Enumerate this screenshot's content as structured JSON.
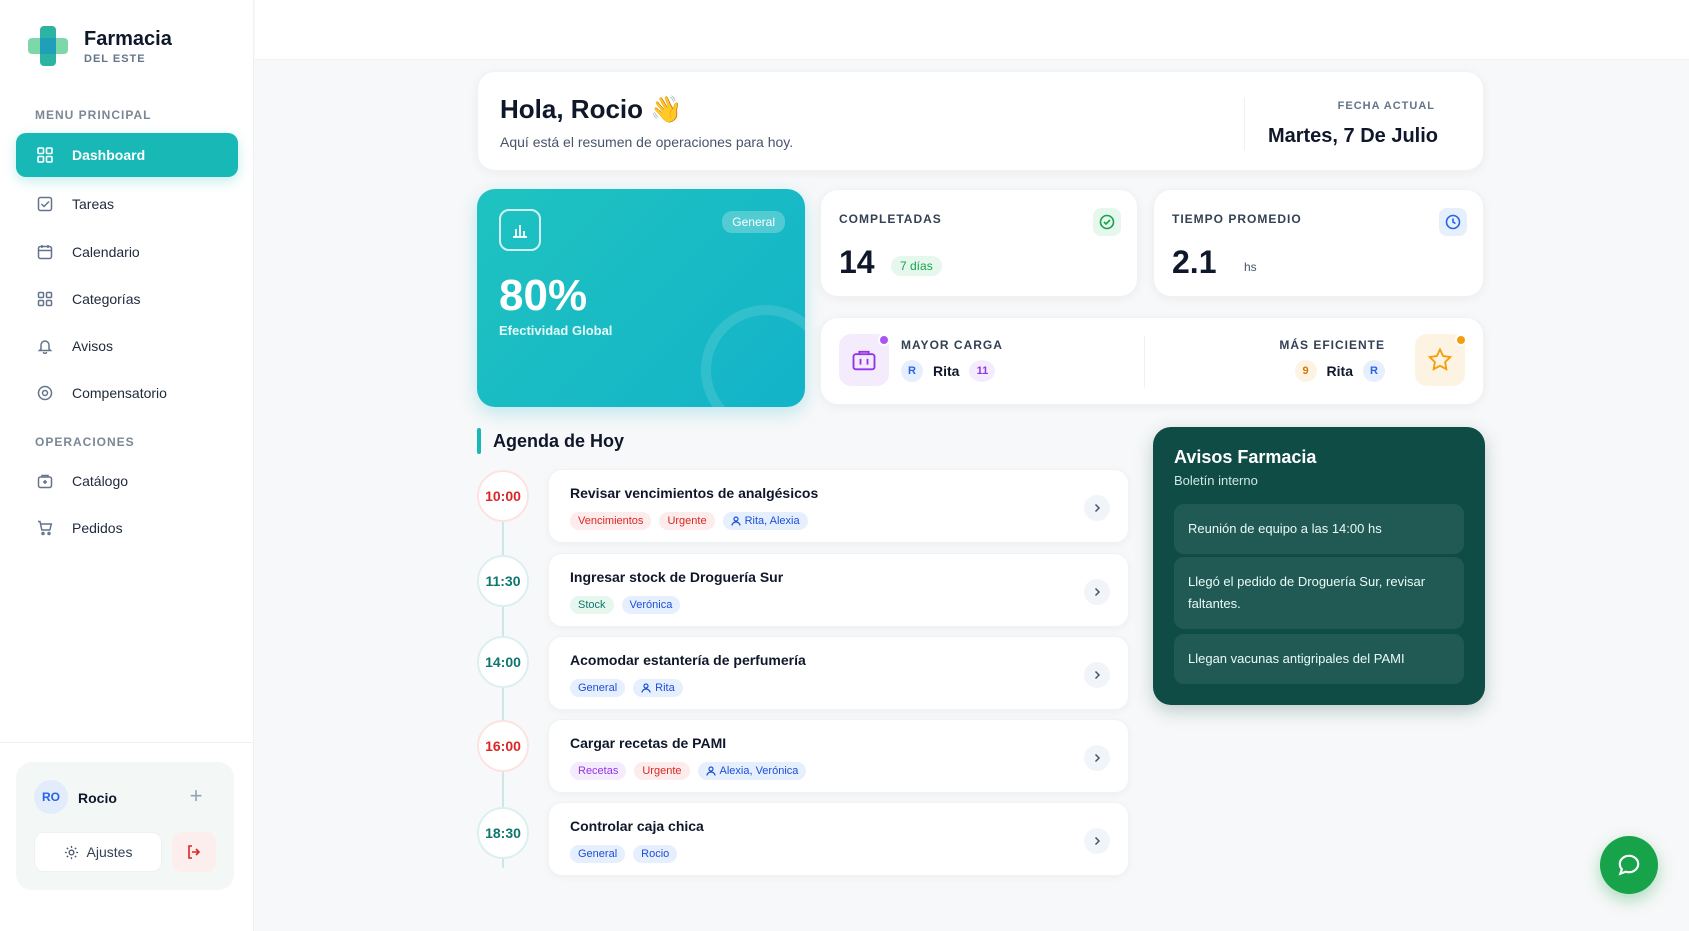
{
  "brand": {
    "name": "Farmacia",
    "sub": "DEL ESTE"
  },
  "sidebar": {
    "section_main": "MENU PRINCIPAL",
    "section_ops": "OPERACIONES",
    "items": [
      {
        "label": "Dashboard",
        "icon": "grid-icon",
        "active": true
      },
      {
        "label": "Tareas",
        "icon": "checkbox-icon"
      },
      {
        "label": "Calendario",
        "icon": "calendar-icon"
      },
      {
        "label": "Categorías",
        "icon": "categories-icon"
      },
      {
        "label": "Avisos",
        "icon": "bell-icon"
      },
      {
        "label": "Compensatorio",
        "icon": "target-icon"
      },
      {
        "label": "Catálogo",
        "icon": "package-icon"
      },
      {
        "label": "Pedidos",
        "icon": "cart-icon"
      }
    ],
    "user": {
      "initials": "RO",
      "name": "Rocio",
      "settings_label": "Ajustes"
    }
  },
  "welcome": {
    "greeting": "Hola, Rocio 👋",
    "subtitle": "Aquí está el resumen de operaciones para hoy.",
    "date_label": "FECHA ACTUAL",
    "date_value": "Martes, 7 De Julio"
  },
  "effectiveness": {
    "badge": "General",
    "value": "80%",
    "label": "Efectividad Global",
    "progress": 0.8
  },
  "completed": {
    "label": "COMPLETADAS",
    "value": "14",
    "chip": "7 días"
  },
  "avg_time": {
    "label": "TIEMPO PROMEDIO",
    "value": "2.1",
    "unit": "hs"
  },
  "load": {
    "max_label": "MAYOR CARGA",
    "max_initial": "R",
    "max_name": "Rita",
    "max_count": "11",
    "eff_label": "MÁS EFICIENTE",
    "eff_count": "9",
    "eff_name": "Rita",
    "eff_initial": "R"
  },
  "agenda": {
    "title": "Agenda de Hoy",
    "tasks": [
      {
        "time": "10:00",
        "title": "Revisar vencimientos de analgésicos",
        "tags": [
          "Vencimientos",
          "Urgente"
        ],
        "people": "Rita, Alexia"
      },
      {
        "time": "11:30",
        "title": "Ingresar stock de Droguería Sur",
        "tags": [
          "Stock",
          "Verónica"
        ]
      },
      {
        "time": "14:00",
        "title": "Acomodar estantería de perfumería",
        "tags": [
          "General"
        ],
        "people": "Rita"
      },
      {
        "time": "16:00",
        "title": "Cargar recetas de PAMI",
        "tags": [
          "Recetas",
          "Urgente"
        ],
        "people": "Alexia, Verónica"
      },
      {
        "time": "18:30",
        "title": "Controlar caja chica",
        "tags": [
          "General",
          "Rocio"
        ]
      }
    ]
  },
  "notices": {
    "title": "Avisos Farmacia",
    "subtitle": "Boletín interno",
    "items": [
      "Reunión de equipo a las 14:00 hs",
      "Llegó el pedido de Droguería Sur, revisar faltantes.",
      "Llegan vacunas antigripales del PAMI"
    ]
  },
  "colors": {
    "accent": "#17b8b6",
    "notices_bg": "#0f4c46",
    "fab": "#16a34a",
    "urgent": "#dc2626"
  }
}
